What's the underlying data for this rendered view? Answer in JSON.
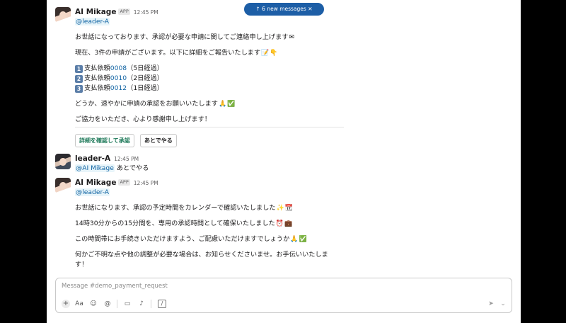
{
  "new_messages_label": "6 new messages",
  "messages": [
    {
      "author": "AI Mikage",
      "badge": "APP",
      "time": "12:45 PM",
      "mention": "@leader-A",
      "line1": "お世話になっております、承認が必要な申請に関してご連絡申し上げます",
      "line2": "現在、3件の申請がございます。以下に詳細をご報告いたします",
      "items": [
        {
          "num": "1",
          "label": "支払依頼",
          "id": "0008",
          "elapsed": "（5日経過）"
        },
        {
          "num": "2",
          "label": "支払依頼",
          "id": "0010",
          "elapsed": "（2日経過）"
        },
        {
          "num": "3",
          "label": "支払依頼",
          "id": "0012",
          "elapsed": "（1日経過）"
        }
      ],
      "line3": "どうか、速やかに申請の承認をお願いいたします",
      "line4": "ご協力をいただき、心より感謝申し上げます！",
      "buttons": {
        "primary": "詳細を確認して承認",
        "secondary": "あとでやる"
      }
    },
    {
      "author": "leader-A",
      "time": "12:45 PM",
      "mention": "@AI Mikage",
      "text": " あとでやる"
    },
    {
      "author": "AI Mikage",
      "badge": "APP",
      "time": "12:45 PM",
      "mention": "@leader-A",
      "line1": "お世話になります、承認の予定時間をカレンダーで確認いたしました",
      "line2": "14時30分からの15分間を、専用の承認時間として確保いたしました",
      "line3": "この時間帯にお手続きいただけますよう、ご配慮いただけますでしょうか",
      "line4a": "何かご不明な点や他の調整が必要な場合は、お知らせくださいませ。お手伝いいたしま",
      "line4b": "す！"
    }
  ],
  "composer": {
    "placeholder": "Message #demo_payment_request",
    "tools": {
      "plus": "+",
      "format": "Aa",
      "emoji": "☺",
      "mention": "@",
      "video": "▭",
      "audio": "♪",
      "shortcut": "/",
      "send": "➤",
      "more": "⌄"
    }
  },
  "emoji": {
    "envelope": "✉",
    "memo": "📝",
    "point_down": "👇",
    "pray": "🙏",
    "check": "✅",
    "sparkles": "✨",
    "calendar": "📆",
    "alarm": "⏰",
    "briefcase": "💼"
  }
}
